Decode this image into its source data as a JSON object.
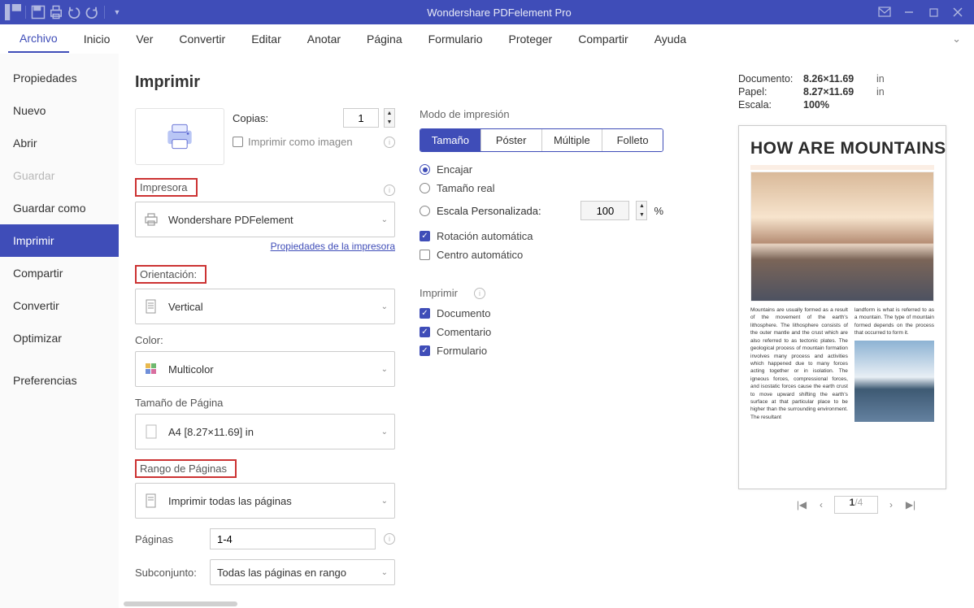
{
  "titlebar": {
    "title": "Wondershare PDFelement Pro"
  },
  "menubar": [
    "Archivo",
    "Inicio",
    "Ver",
    "Convertir",
    "Editar",
    "Anotar",
    "Página",
    "Formulario",
    "Proteger",
    "Compartir",
    "Ayuda"
  ],
  "active_menu": 0,
  "sidebar": {
    "items": [
      "Propiedades",
      "Nuevo",
      "Abrir",
      "Guardar",
      "Guardar como",
      "Imprimir",
      "Compartir",
      "Convertir",
      "Optimizar"
    ],
    "pref": "Preferencias",
    "selected": "Imprimir",
    "disabled": [
      "Guardar"
    ]
  },
  "print": {
    "heading": "Imprimir",
    "copies_label": "Copias:",
    "copies_value": "1",
    "print_as_image": "Imprimir como imagen",
    "printer_section": "Impresora",
    "printer_name": "Wondershare PDFelement",
    "printer_props_link": "Propiedades de la impresora",
    "orientation_section": "Orientación:",
    "orientation_value": "Vertical",
    "color_label": "Color:",
    "color_value": "Multicolor",
    "page_size_label": "Tamaño de Página",
    "page_size_value": "A4 [8.27×11.69] in",
    "page_range_section": "Rango de Páginas",
    "page_range_value": "Imprimir todas las páginas",
    "pages_label": "Páginas",
    "pages_value": "1-4",
    "subset_label": "Subconjunto:",
    "subset_value": "Todas las páginas en rango"
  },
  "mode": {
    "label": "Modo de impresión",
    "tabs": [
      "Tamaño",
      "Póster",
      "Múltiple",
      "Folleto"
    ],
    "active": 0,
    "fit": "Encajar",
    "real": "Tamaño real",
    "custom": "Escala Personalizada:",
    "scale_value": "100",
    "percent": "%",
    "auto_rotate": "Rotación automática",
    "auto_center": "Centro automático",
    "print_what": "Imprimir",
    "doc": "Documento",
    "comment": "Comentario",
    "form": "Formulario"
  },
  "meta": {
    "doc_label": "Documento:",
    "doc_val": "8.26×11.69",
    "doc_unit": "in",
    "paper_label": "Papel:",
    "paper_val": "8.27×11.69",
    "paper_unit": "in",
    "scale_label": "Escala:",
    "scale_val": "100%"
  },
  "preview": {
    "title": "HOW ARE MOUNTAINS FORMED",
    "col1": "Mountains are usually formed as a result of the movement of the earth's lithosphere. The lithosphere consists of the outer mantle and the crust which are also referred to as tectonic plates. The geological process of mountain formation involves many process and activities which happened due to many forces acting together or in isolation. The igneous forces, compressional forces, and isostatic forces cause the earth crust to move upward shifting the earth's surface at that particular place to be higher than the surrounding environment. The resultant",
    "col2": "landform is what is referred to as a mountain. The type of mountain formed depends on the process that occurred to form it.",
    "page_current": "1",
    "page_total": "/4"
  }
}
